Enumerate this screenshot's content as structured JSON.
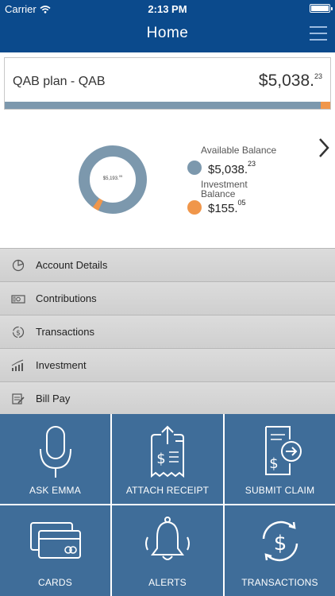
{
  "status_bar": {
    "carrier": "Carrier",
    "time": "2:13 PM"
  },
  "nav": {
    "title": "Home",
    "menu_icon": "hamburger-icon"
  },
  "plan": {
    "name": "QAB plan - QAB",
    "amount": "$5,038.",
    "amount_cents": "23",
    "available_fraction": 0.97,
    "investment_fraction": 0.03
  },
  "summary": {
    "total": "$5,193.",
    "total_cents": "05",
    "available": {
      "label": "Available Balance",
      "amount": "$5,038.",
      "cents": "23",
      "color": "#7c98ad"
    },
    "investment": {
      "label_line1": "Investment",
      "label_line2": "Balance",
      "amount": "$155.",
      "cents": "05",
      "color": "#f0964a"
    }
  },
  "menu": [
    {
      "label": "Account Details",
      "icon": "account-details-icon"
    },
    {
      "label": "Contributions",
      "icon": "contributions-icon"
    },
    {
      "label": "Transactions",
      "icon": "transactions-icon"
    },
    {
      "label": "Investment",
      "icon": "investment-icon"
    },
    {
      "label": "Bill Pay",
      "icon": "bill-pay-icon"
    }
  ],
  "tiles": [
    {
      "label": "ASK EMMA",
      "icon": "microphone-icon"
    },
    {
      "label": "ATTACH RECEIPT",
      "icon": "receipt-icon"
    },
    {
      "label": "SUBMIT CLAIM",
      "icon": "submit-claim-icon"
    },
    {
      "label": "CARDS",
      "icon": "card-icon"
    },
    {
      "label": "ALERTS",
      "icon": "bell-icon"
    },
    {
      "label": "TRANSACTIONS",
      "icon": "dollar-cycle-icon"
    }
  ],
  "colors": {
    "nav": "#0b4a8c",
    "tile": "#3f6d99",
    "available": "#7c98ad",
    "investment": "#f0964a"
  }
}
